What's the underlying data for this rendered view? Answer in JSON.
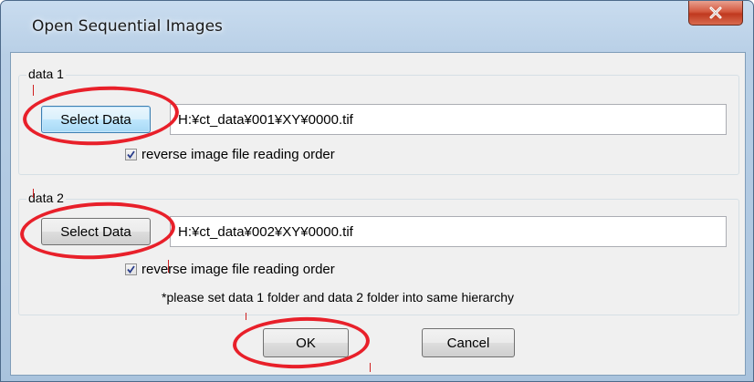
{
  "window": {
    "title": "Open Sequential Images",
    "close_icon": "close-icon"
  },
  "group1": {
    "label": "data 1",
    "select_label": "Select Data",
    "path_value": "H:¥ct_data¥001¥XY¥0000.tif",
    "reverse_label": "reverse image file reading order",
    "reverse_checked": true
  },
  "group2": {
    "label": "data 2",
    "select_label": "Select Data",
    "path_value": "H:¥ct_data¥002¥XY¥0000.tif",
    "reverse_label": "reverse image file reading order",
    "reverse_checked": true,
    "note": "*please set data 1 folder and data 2 folder into same hierarchy"
  },
  "footer": {
    "ok_label": "OK",
    "cancel_label": "Cancel"
  },
  "colors": {
    "annotation": "#e8202a",
    "focus_border": "#3c7fb1"
  }
}
